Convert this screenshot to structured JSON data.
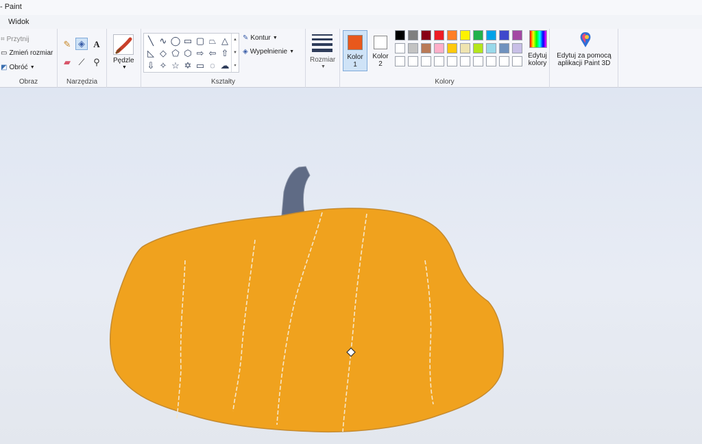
{
  "window": {
    "title": "- Paint"
  },
  "menu": {
    "view": "Widok"
  },
  "image_group": {
    "label": "Obraz",
    "crop": "Przytnij",
    "resize": "Zmień rozmiar",
    "rotate": "Obróć"
  },
  "tools_group": {
    "label": "Narzędzia"
  },
  "brushes": {
    "label": "Pędzle"
  },
  "shapes_group": {
    "label": "Kształty",
    "outline": "Kontur",
    "fill": "Wypełnienie"
  },
  "size": {
    "label": "Rozmiar"
  },
  "color1": {
    "label": "Kolor 1",
    "line1": "Kolor",
    "line2": "1",
    "value": "#e8581c"
  },
  "color2": {
    "label": "Kolor 2",
    "line1": "Kolor",
    "line2": "2",
    "value": "#ffffff"
  },
  "colors_group": {
    "label": "Kolory",
    "edit_line1": "Edytuj",
    "edit_line2": "kolory",
    "palette_row1": [
      "#000000",
      "#7f7f7f",
      "#880015",
      "#ed1c24",
      "#ff7f27",
      "#fff200",
      "#22b14c",
      "#00a2e8",
      "#3f48cc",
      "#a349a4"
    ],
    "palette_row2": [
      "#ffffff",
      "#c3c3c3",
      "#b97a57",
      "#ffaec9",
      "#ffc90e",
      "#efe4b0",
      "#b5e61d",
      "#99d9ea",
      "#7092be",
      "#c8bfe7"
    ],
    "palette_row3": [
      "#ffffff",
      "#ffffff",
      "#ffffff",
      "#ffffff",
      "#ffffff",
      "#ffffff",
      "#ffffff",
      "#ffffff",
      "#ffffff",
      "#ffffff"
    ]
  },
  "paint3d": {
    "line1": "Edytuj za pomocą",
    "line2": "aplikacji Paint 3D"
  },
  "drawing": {
    "pumpkin_color": "#f0a21e",
    "stem_color": "#5f6b85"
  }
}
